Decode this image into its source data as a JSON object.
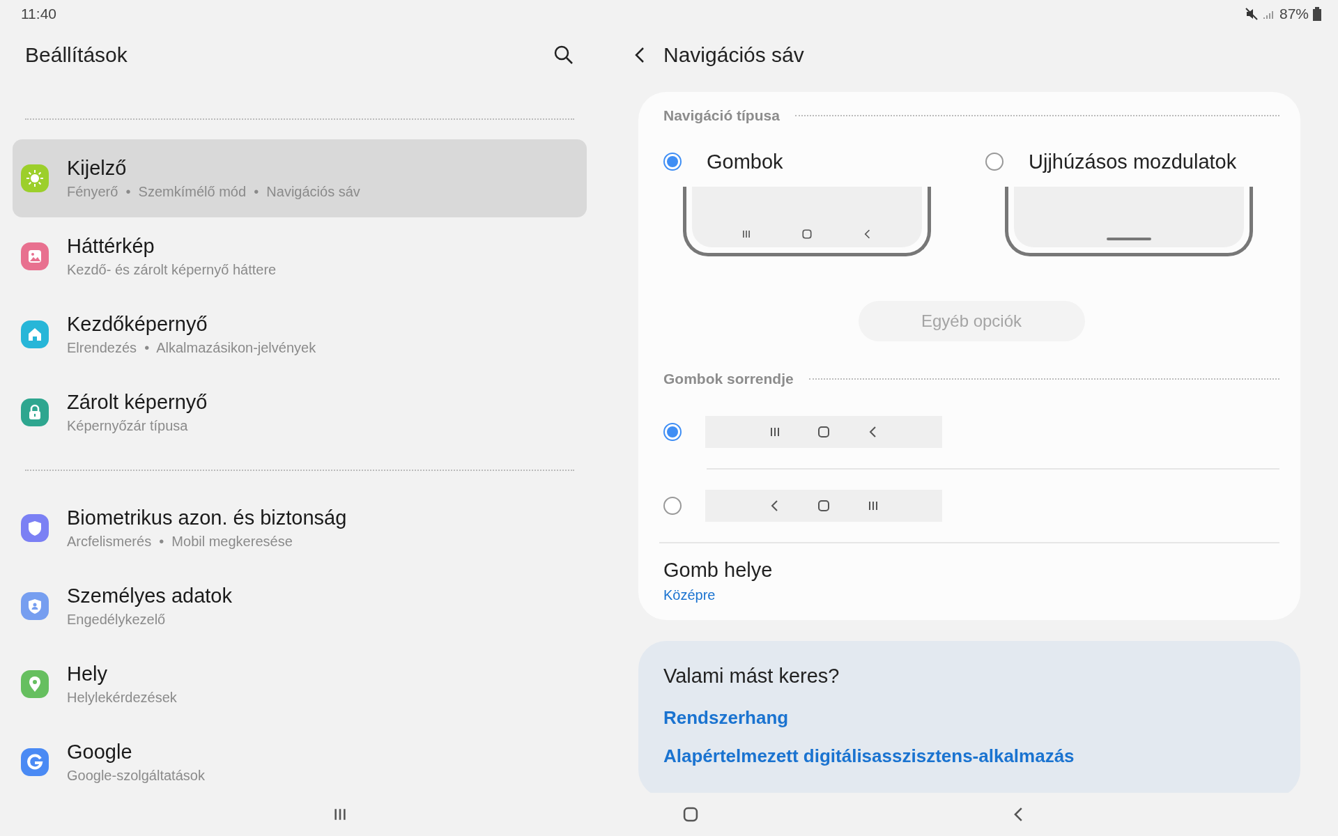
{
  "status_bar": {
    "time": "11:40",
    "battery": "87%"
  },
  "settings": {
    "title": "Beállítások",
    "groups": [
      {
        "items": [
          {
            "color": "#9ccf2b",
            "title": "Kijelző",
            "subtitle": "Fényerő  •  Szemkímélő mód  •  Navigációs sáv",
            "selected": true
          },
          {
            "color": "#e8708f",
            "title": "Háttérkép",
            "subtitle": "Kezdő- és zárolt képernyő háttere",
            "selected": false
          },
          {
            "color": "#27b6d8",
            "title": "Kezdőképernyő",
            "subtitle": "Elrendezés  •  Alkalmazásikon-jelvények",
            "selected": false
          },
          {
            "color": "#2ea68f",
            "title": "Zárolt képernyő",
            "subtitle": "Képernyőzár típusa",
            "selected": false
          }
        ]
      },
      {
        "items": [
          {
            "color": "#7b80f4",
            "title": "Biometrikus azon. és biztonság",
            "subtitle": "Arcfelismerés  •  Mobil megkeresése",
            "selected": false
          },
          {
            "color": "#769ef0",
            "title": "Személyes adatok",
            "subtitle": "Engedélykezelő",
            "selected": false
          },
          {
            "color": "#66bf5f",
            "title": "Hely",
            "subtitle": "Helylekérdezések",
            "selected": false
          },
          {
            "color": "#4a8af4",
            "title": "Google",
            "subtitle": "Google-szolgáltatások",
            "selected": false
          }
        ]
      }
    ]
  },
  "detail": {
    "title": "Navigációs sáv",
    "nav_type": {
      "header": "Navigáció típusa",
      "options": [
        {
          "kind": "buttons",
          "label": "Gombok",
          "selected": true
        },
        {
          "kind": "gesture",
          "label": "Ujjhúzásos mozdulatok",
          "selected": false
        }
      ]
    },
    "more_button": {
      "label": "Egyéb opciók",
      "disabled": true
    },
    "order": {
      "header": "Gombok sorrendje",
      "options": [
        {
          "kind": "standard",
          "selected": true
        },
        {
          "kind": "reversed",
          "selected": false
        }
      ]
    },
    "position": {
      "title": "Gomb helye",
      "value": "Középre"
    },
    "suggestions": {
      "title": "Valami mást keres?",
      "links": [
        "Rendszerhang",
        "Alapértelmezett digitálisasszisztens-alkalmazás"
      ]
    }
  }
}
